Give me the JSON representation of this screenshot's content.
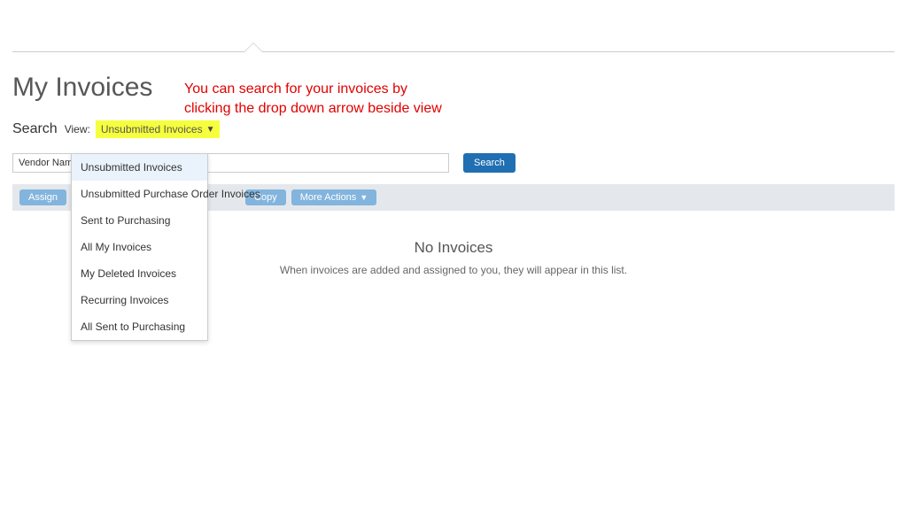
{
  "page_title": "My Invoices",
  "annotation": "You can search for your invoices by clicking the drop down arrow beside view",
  "search": {
    "label": "Search",
    "view_label": "View:",
    "view_selected": "Unsubmitted Invoices",
    "vendor_select": "Vendor Name",
    "input_value": "",
    "button": "Search"
  },
  "view_options": [
    "Unsubmitted Invoices",
    "Unsubmitted Purchase Order Invoices",
    "Sent to Purchasing",
    "All My Invoices",
    "My Deleted Invoices",
    "Recurring Invoices",
    "All Sent to Purchasing"
  ],
  "actions": {
    "assign": "Assign",
    "copy": "Copy",
    "more": "More Actions"
  },
  "empty": {
    "title": "No Invoices",
    "subtitle": "When invoices are added and assigned to you, they will appear in this list."
  }
}
